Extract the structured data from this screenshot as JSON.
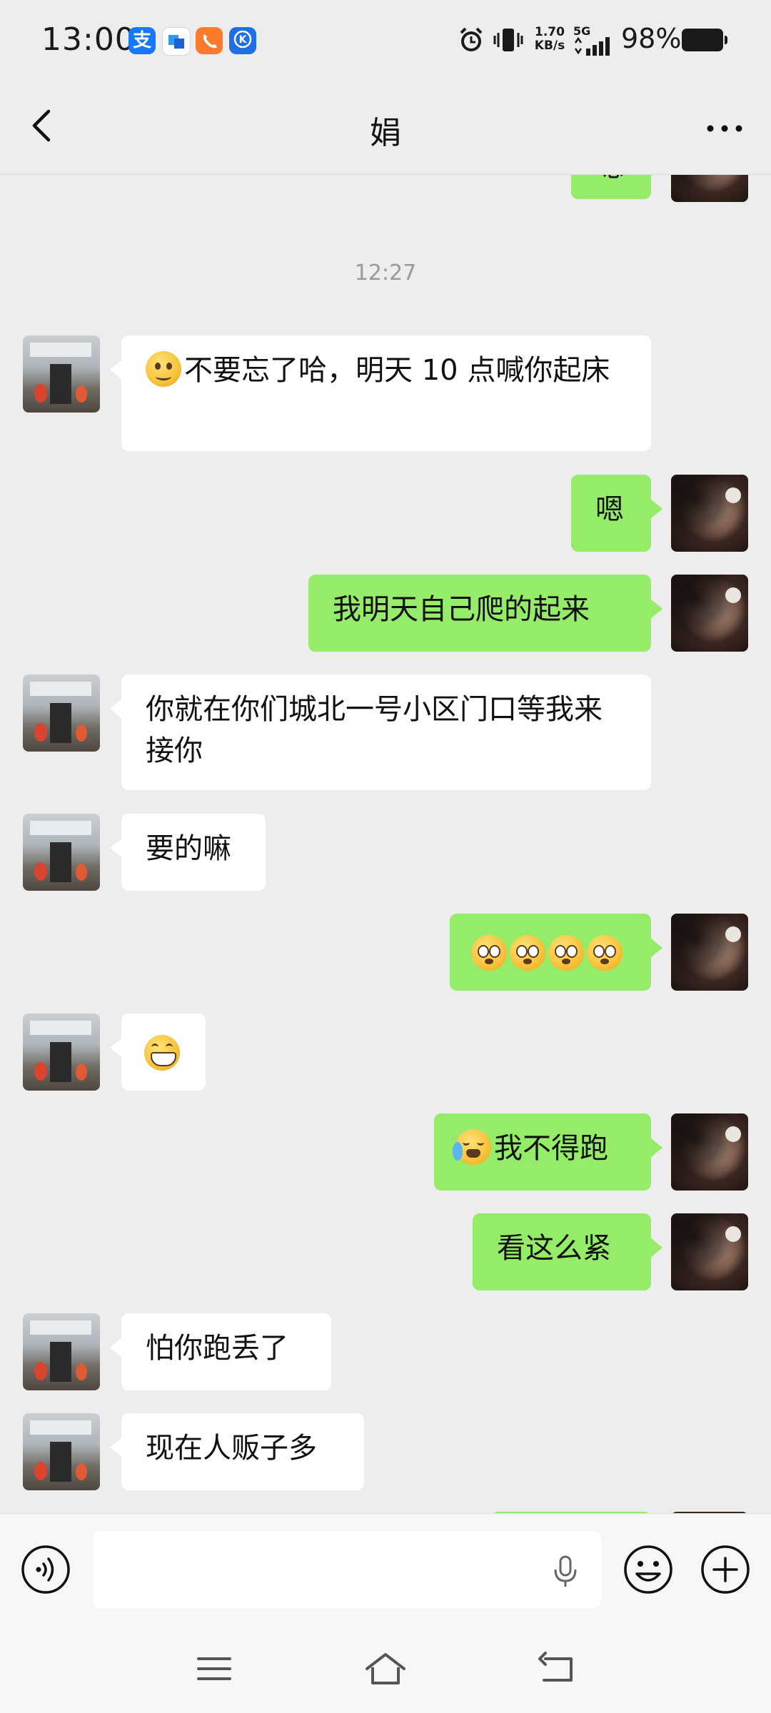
{
  "status_bar": {
    "time": "13:00",
    "app_icons": [
      {
        "name": "alipay-icon",
        "glyph": "支",
        "color": "#1677ff"
      },
      {
        "name": "cloud-app-icon",
        "glyph": "▪",
        "color": "#2f7fe8"
      },
      {
        "name": "call-app-icon",
        "glyph": "✆",
        "color": "#ff7a2d"
      },
      {
        "name": "k-app-icon",
        "glyph": "K",
        "color": "#1e6fe6"
      }
    ],
    "net_speed_value": "1.70",
    "net_speed_unit": "KB/s",
    "network": "5G",
    "battery_percent": "98%"
  },
  "header": {
    "title": "娟"
  },
  "chat": {
    "timestamp": "12:27",
    "messages": [
      {
        "side": "right",
        "text": "嗯"
      },
      {
        "side": "left",
        "emoji": "smile",
        "text": "不要忘了哈，明天 10 点喊你起床"
      },
      {
        "side": "right",
        "text": "嗯"
      },
      {
        "side": "right",
        "text": "我明天自己爬的起来"
      },
      {
        "side": "left",
        "text": "你就在你们城北一号小区门口等我来接你"
      },
      {
        "side": "left",
        "text": "要的嘛"
      },
      {
        "side": "right",
        "emoji": "flushed x4",
        "text": ""
      },
      {
        "side": "left",
        "emoji": "grin",
        "text": ""
      },
      {
        "side": "right",
        "emoji": "cry-laugh",
        "text": "我不得跑"
      },
      {
        "side": "right",
        "text": "看这么紧"
      },
      {
        "side": "left",
        "text": "怕你跑丢了"
      },
      {
        "side": "left",
        "text": "现在人贩子多"
      }
    ]
  },
  "input_bar": {
    "placeholder": ""
  },
  "colors": {
    "background": "#ededed",
    "bubble_self": "#95ec69",
    "bubble_other": "#ffffff"
  }
}
